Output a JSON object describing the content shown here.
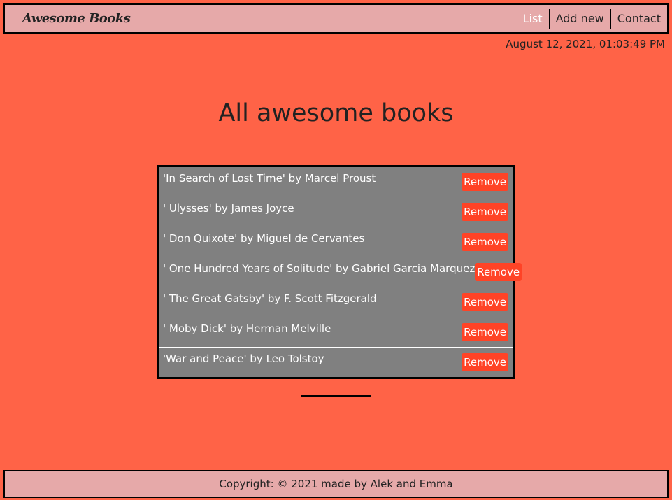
{
  "navbar": {
    "brand": "Awesome Books",
    "links": [
      {
        "label": "List",
        "active": true
      },
      {
        "label": "Add new",
        "active": false
      },
      {
        "label": "Contact",
        "active": false
      }
    ]
  },
  "datetime": "August 12, 2021, 01:03:49 PM",
  "main": {
    "title": "All awesome books",
    "books": [
      {
        "text": "'In Search of Lost Time' by Marcel Proust",
        "remove_label": "Remove"
      },
      {
        "text": "' Ulysses' by James Joyce",
        "remove_label": "Remove"
      },
      {
        "text": "' Don Quixote' by Miguel de Cervantes",
        "remove_label": "Remove"
      },
      {
        "text": "' One Hundred Years of Solitude' by Gabriel Garcia Marquez",
        "remove_label": "Remove"
      },
      {
        "text": "' The Great Gatsby' by F. Scott Fitzgerald",
        "remove_label": "Remove"
      },
      {
        "text": "' Moby Dick' by Herman Melville",
        "remove_label": "Remove"
      },
      {
        "text": "'War and Peace' by Leo Tolstoy",
        "remove_label": "Remove"
      }
    ]
  },
  "footer": {
    "copyright": "Copyright: © 2021 made by Alek and Emma"
  },
  "colors": {
    "background": "#ff6347",
    "navbar": "#e6a9a9",
    "list_bg": "#808080",
    "remove_button": "#ff4326"
  }
}
